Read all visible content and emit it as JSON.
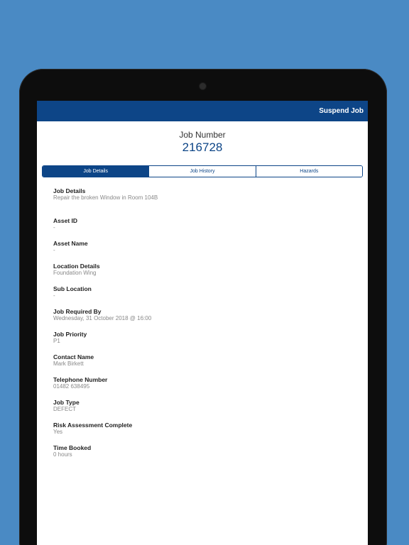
{
  "topbar": {
    "suspend_label": "Suspend Job"
  },
  "job": {
    "number_label": "Job Number",
    "number": "216728"
  },
  "tabs": [
    {
      "label": "Job Details",
      "active": true
    },
    {
      "label": "Job History",
      "active": false
    },
    {
      "label": "Hazards",
      "active": false
    }
  ],
  "fields": [
    {
      "label": "Job Details",
      "value": "Repair the broken Window in Room 104B"
    },
    {
      "label": "Asset ID",
      "value": "-"
    },
    {
      "label": "Asset Name",
      "value": "-"
    },
    {
      "label": "Location Details",
      "value": "Foundation Wing"
    },
    {
      "label": "Sub Location",
      "value": "-"
    },
    {
      "label": "Job Required By",
      "value": "Wednesday, 31 October 2018 @ 16:00"
    },
    {
      "label": "Job Priority",
      "value": "P1"
    },
    {
      "label": "Contact Name",
      "value": "Mark Birkett"
    },
    {
      "label": "Telephone Number",
      "value": "01482 638495"
    },
    {
      "label": "Job Type",
      "value": "DEFECT"
    },
    {
      "label": "Risk Assessment Complete",
      "value": "Yes"
    },
    {
      "label": "Time Booked",
      "value": "0 hours"
    }
  ],
  "colors": {
    "primary": "#0d4587",
    "background": "#4a8ac4"
  }
}
